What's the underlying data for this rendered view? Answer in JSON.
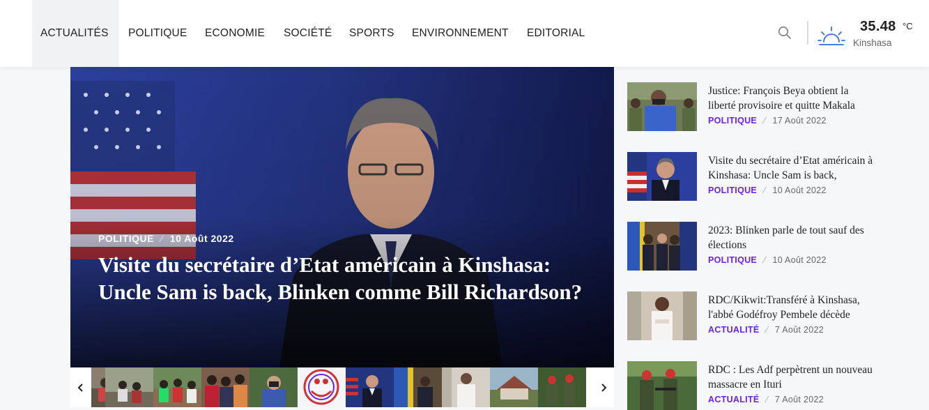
{
  "nav": {
    "items": [
      {
        "label": "ACTUALITÉS",
        "active": true
      },
      {
        "label": "POLITIQUE",
        "active": false
      },
      {
        "label": "ECONOMIE",
        "active": false
      },
      {
        "label": "SOCIÉTÉ",
        "active": false
      },
      {
        "label": "SPORTS",
        "active": false
      },
      {
        "label": "ENVIRONNEMENT",
        "active": false
      },
      {
        "label": "EDITORIAL",
        "active": false
      }
    ],
    "search_icon": "search-icon",
    "weather": {
      "icon": "sunrise-icon",
      "temperature": "35.48",
      "unit": "°C",
      "city": "Kinshasa"
    }
  },
  "hero": {
    "category": "POLITIQUE",
    "separator": "⁄",
    "date": "10 Août 2022",
    "title": "Visite du secrétaire d’Etat américain à Kinshasa: Uncle Sam is back, Blinken comme Bill Richardson?"
  },
  "thumbstrip": {
    "prev_icon": "chevron-left-icon",
    "next_icon": "chevron-right-icon",
    "count": 11
  },
  "sidebar": {
    "posts": [
      {
        "title": "Justice: François Beya obtient la liberté provisoire et quitte Makala",
        "category": "POLITIQUE",
        "separator": "⁄",
        "date": "17 Août 2022"
      },
      {
        "title": "Visite du secrétaire d’Etat américain à Kinshasa: Uncle Sam is back,",
        "category": "POLITIQUE",
        "separator": "⁄",
        "date": "10 Août 2022"
      },
      {
        "title": "2023: Blinken parle de tout sauf des élections",
        "category": "POLITIQUE",
        "separator": "⁄",
        "date": "10 Août 2022"
      },
      {
        "title": "RDC/Kikwit:Transféré à Kinshasa, l'abbé Godéfroy Pembele décède",
        "category": "ACTUALITÉ",
        "separator": "⁄",
        "date": "7 Août 2022"
      },
      {
        "title": "RDC : Les Adf perpètrent un nouveau massacre en Ituri",
        "category": "ACTUALITÉ",
        "separator": "⁄",
        "date": "7 Août 2022"
      }
    ]
  },
  "colors": {
    "accent": "#6b21e8",
    "nav_active_bg": "#f1f2f4",
    "hero_overlay": "#10183f"
  }
}
